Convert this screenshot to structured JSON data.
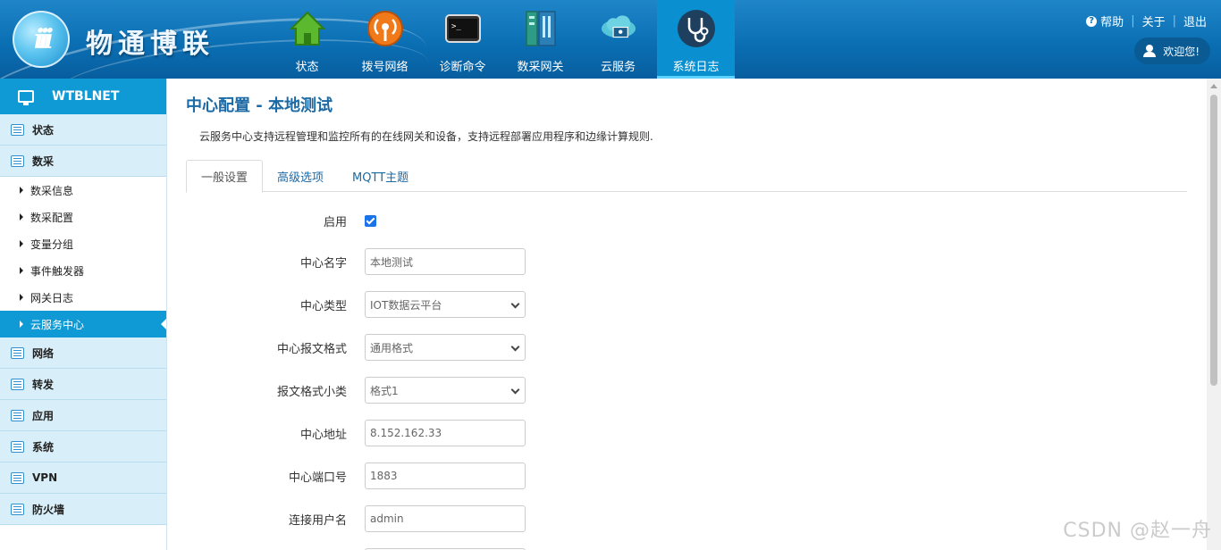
{
  "header": {
    "logo_letter": "iii",
    "logo_text": "物通博联",
    "nav": [
      {
        "label": "状态",
        "icon": "house-icon"
      },
      {
        "label": "拨号网络",
        "icon": "broadcast-icon"
      },
      {
        "label": "诊断命令",
        "icon": "terminal-icon"
      },
      {
        "label": "数采网关",
        "icon": "gateway-icon"
      },
      {
        "label": "云服务",
        "icon": "cloud-icon"
      },
      {
        "label": "系统日志",
        "icon": "stethoscope-icon",
        "active": true
      }
    ],
    "help": "帮助",
    "about": "关于",
    "logout": "退出",
    "welcome": "欢迎您!"
  },
  "sidebar": {
    "brand": "WTBLNET",
    "groups": {
      "status": "状态",
      "collect": "数采",
      "network": "网络",
      "forward": "转发",
      "app": "应用",
      "system": "系统",
      "vpn": "VPN",
      "firewall": "防火墙"
    },
    "collect_items": [
      "数采信息",
      "数采配置",
      "变量分组",
      "事件触发器",
      "网关日志",
      "云服务中心"
    ],
    "active_item": "云服务中心"
  },
  "main": {
    "title": "中心配置 - 本地测试",
    "description": "云服务中心支持远程管理和监控所有的在线网关和设备，支持远程部署应用程序和边缘计算规则.",
    "tabs": [
      "一般设置",
      "高级选项",
      "MQTT主题"
    ],
    "form": {
      "enable_label": "启用",
      "enable_checked": true,
      "name_label": "中心名字",
      "name_value": "本地测试",
      "type_label": "中心类型",
      "type_value": "IOT数据云平台",
      "format_label": "中心报文格式",
      "format_value": "通用格式",
      "subformat_label": "报文格式小类",
      "subformat_value": "格式1",
      "address_label": "中心地址",
      "address_value": "8.152.162.33",
      "port_label": "中心端口号",
      "port_value": "1883",
      "username_label": "连接用户名",
      "username_value": "admin"
    }
  },
  "watermark": "CSDN @赵一舟",
  "colors": {
    "header_blue": "#0b6fb4",
    "accent": "#0f9ad6",
    "title_blue": "#1c6aa5",
    "sidebar_group_bg": "#d8eef8",
    "checkbox_blue": "#1a73e8"
  }
}
